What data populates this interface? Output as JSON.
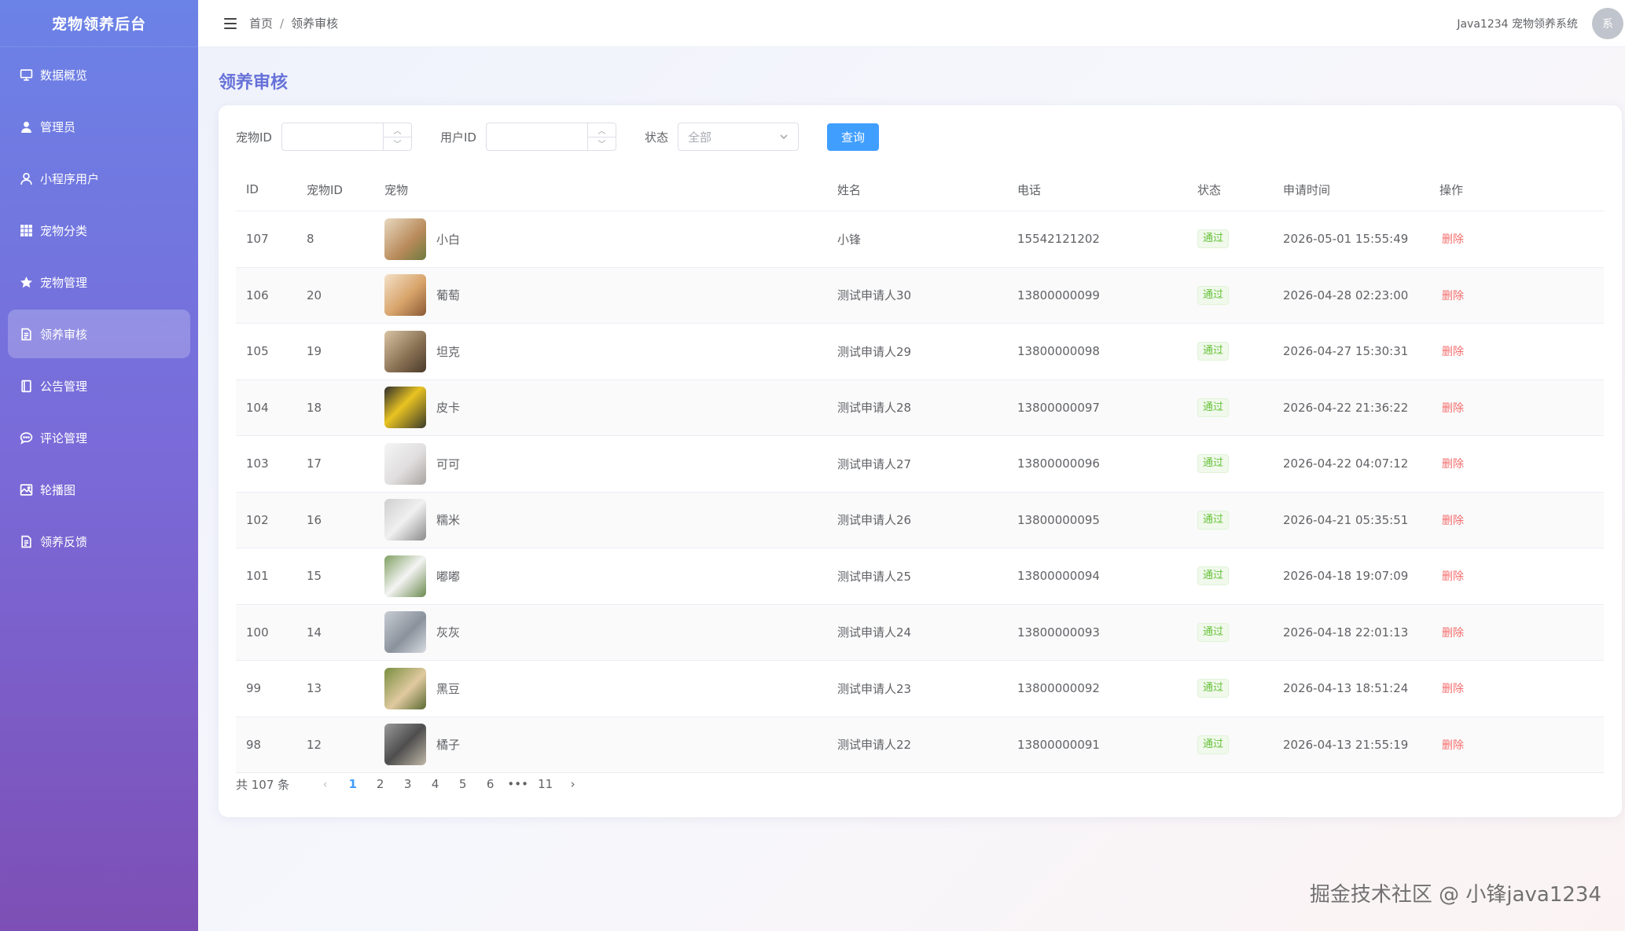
{
  "sidebar": {
    "brand": "宠物领养后台",
    "items": [
      {
        "label": "数据概览",
        "icon": "monitor-icon"
      },
      {
        "label": "管理员",
        "icon": "user-filled-icon"
      },
      {
        "label": "小程序用户",
        "icon": "user-icon"
      },
      {
        "label": "宠物分类",
        "icon": "grid-icon"
      },
      {
        "label": "宠物管理",
        "icon": "star-icon"
      },
      {
        "label": "领养审核",
        "icon": "document-icon",
        "active": true
      },
      {
        "label": "公告管理",
        "icon": "notebook-icon"
      },
      {
        "label": "评论管理",
        "icon": "chat-icon"
      },
      {
        "label": "轮播图",
        "icon": "picture-icon"
      },
      {
        "label": "领养反馈",
        "icon": "document-icon"
      }
    ]
  },
  "header": {
    "breadcrumb_home": "首页",
    "breadcrumb_sep": "/",
    "breadcrumb_current": "领养审核",
    "system_name": "Java1234 宠物领养系统",
    "avatar_text": "系"
  },
  "page": {
    "title": "领养审核"
  },
  "filters": {
    "pet_id_label": "宠物ID",
    "user_id_label": "用户ID",
    "status_label": "状态",
    "status_placeholder": "全部",
    "search_button": "查询"
  },
  "table": {
    "columns": [
      "ID",
      "宠物ID",
      "宠物",
      "姓名",
      "电话",
      "状态",
      "申请时间",
      "操作"
    ],
    "rows": [
      {
        "id": "107",
        "pet_id": "8",
        "pet": "小白",
        "name": "小锋",
        "phone": "15542121202",
        "status": "通过",
        "time": "2026-05-01 15:55:49",
        "op": "删除"
      },
      {
        "id": "106",
        "pet_id": "20",
        "pet": "葡萄",
        "name": "测试申请人30",
        "phone": "13800000099",
        "status": "通过",
        "time": "2026-04-28 02:23:00",
        "op": "删除"
      },
      {
        "id": "105",
        "pet_id": "19",
        "pet": "坦克",
        "name": "测试申请人29",
        "phone": "13800000098",
        "status": "通过",
        "time": "2026-04-27 15:30:31",
        "op": "删除"
      },
      {
        "id": "104",
        "pet_id": "18",
        "pet": "皮卡",
        "name": "测试申请人28",
        "phone": "13800000097",
        "status": "通过",
        "time": "2026-04-22 21:36:22",
        "op": "删除"
      },
      {
        "id": "103",
        "pet_id": "17",
        "pet": "可可",
        "name": "测试申请人27",
        "phone": "13800000096",
        "status": "通过",
        "time": "2026-04-22 04:07:12",
        "op": "删除"
      },
      {
        "id": "102",
        "pet_id": "16",
        "pet": "糯米",
        "name": "测试申请人26",
        "phone": "13800000095",
        "status": "通过",
        "time": "2026-04-21 05:35:51",
        "op": "删除"
      },
      {
        "id": "101",
        "pet_id": "15",
        "pet": "嘟嘟",
        "name": "测试申请人25",
        "phone": "13800000094",
        "status": "通过",
        "time": "2026-04-18 19:07:09",
        "op": "删除"
      },
      {
        "id": "100",
        "pet_id": "14",
        "pet": "灰灰",
        "name": "测试申请人24",
        "phone": "13800000093",
        "status": "通过",
        "time": "2026-04-18 22:01:13",
        "op": "删除"
      },
      {
        "id": "99",
        "pet_id": "13",
        "pet": "黑豆",
        "name": "测试申请人23",
        "phone": "13800000092",
        "status": "通过",
        "time": "2026-04-13 18:51:24",
        "op": "删除"
      },
      {
        "id": "98",
        "pet_id": "12",
        "pet": "橘子",
        "name": "测试申请人22",
        "phone": "13800000091",
        "status": "通过",
        "time": "2026-04-13 21:55:19",
        "op": "删除"
      }
    ]
  },
  "pagination": {
    "total_text": "共 107 条",
    "pages": [
      "1",
      "2",
      "3",
      "4",
      "5",
      "6",
      "•••",
      "11"
    ],
    "current": "1"
  },
  "watermark": "掘金技术社区 @ 小锋java1234",
  "colors": {
    "sidebar_top": "#6b82e6",
    "sidebar_bottom": "#7d4fb5",
    "title": "#6672d8",
    "primary": "#409eff",
    "success": "#67c23a",
    "danger": "#f56c6c"
  }
}
